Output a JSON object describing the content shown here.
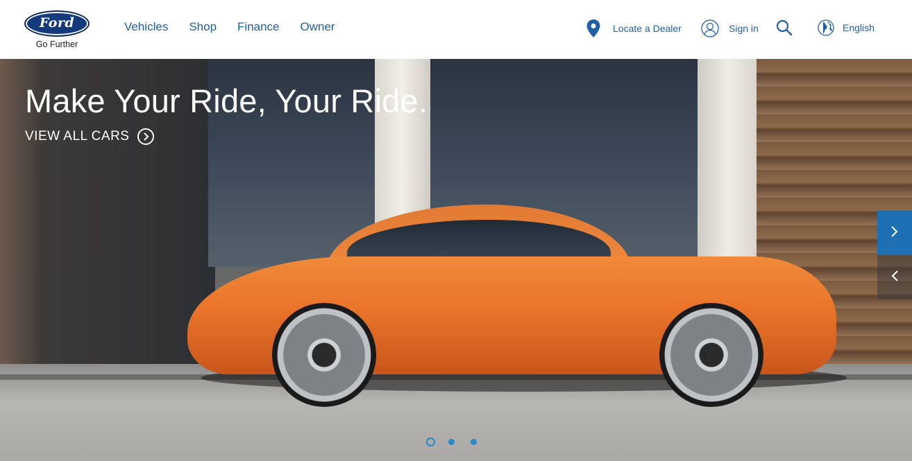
{
  "brand": {
    "logo_text": "Ford",
    "tagline": "Go Further"
  },
  "nav": {
    "items": [
      "Vehicles",
      "Shop",
      "Finance",
      "Owner"
    ]
  },
  "utility": {
    "dealer_label": "Locate a Dealer",
    "sign_in_label": "Sign in",
    "language_label": "English",
    "icons": [
      "map-pin-icon",
      "user-icon",
      "search-icon",
      "globe-icon"
    ]
  },
  "hero": {
    "headline": "Make Your Ride, Your Ride.",
    "cta_label": "VIEW ALL CARS",
    "slide_count": 3,
    "active_slide": 1
  },
  "colors": {
    "link": "#1f5fa5",
    "brand_blue": "#133a7c",
    "accent": "#2a88c9"
  }
}
